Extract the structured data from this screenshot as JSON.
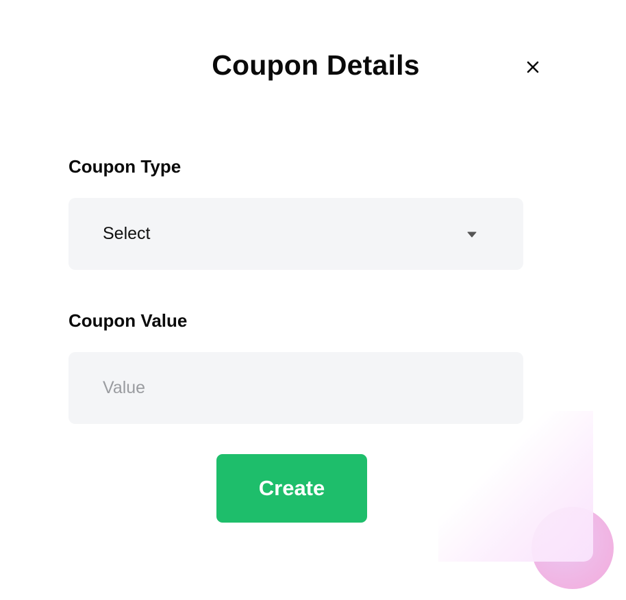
{
  "modal": {
    "title": "Coupon Details",
    "close_icon": "close-icon"
  },
  "coupon_type": {
    "label": "Coupon Type",
    "selected": "Select",
    "dropdown_icon": "chevron-down-icon"
  },
  "coupon_value": {
    "label": "Coupon Value",
    "value": "",
    "placeholder": "Value"
  },
  "actions": {
    "create_label": "Create"
  },
  "colors": {
    "primary_button": "#1ebe6b",
    "field_background": "#f4f5f7",
    "placeholder_text": "#9a9ca0",
    "decor_pink": "#f1b3e2"
  }
}
